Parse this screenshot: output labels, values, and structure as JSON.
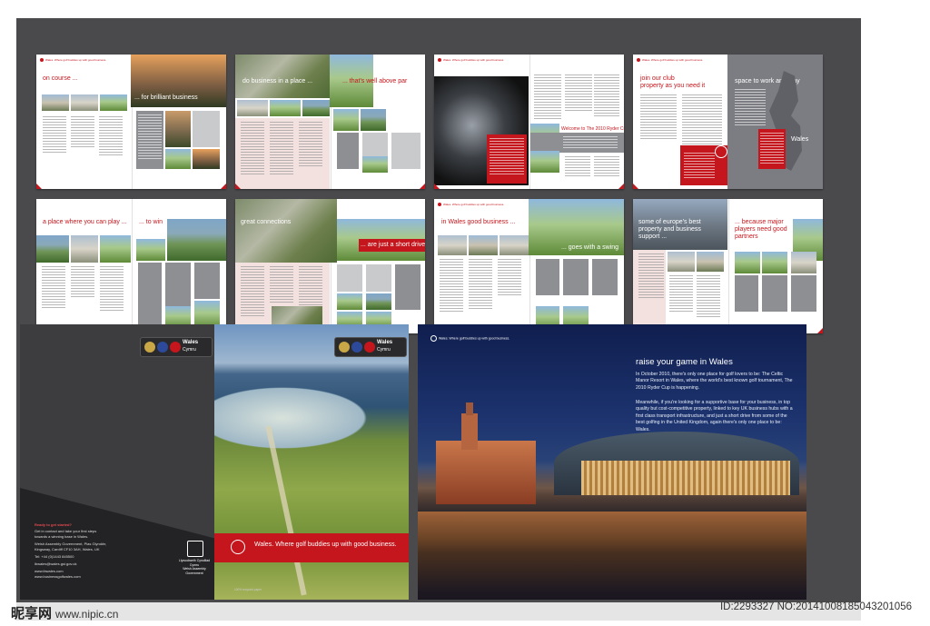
{
  "runner_text": "Wales. Where golf buddies up with good business.",
  "spreads": [
    {
      "id": "on-course",
      "headings": [
        "on course ...",
        "... for brilliant business"
      ]
    },
    {
      "id": "business-place",
      "headings": [
        "do business in a place ...",
        "... that's well above par"
      ]
    },
    {
      "id": "ryder-cup",
      "headings": [
        "Welcome to The 2010 Ryder Cup"
      ]
    },
    {
      "id": "club-property",
      "headings": [
        "join our club",
        "property as you need it",
        "space to work and play",
        "Wales"
      ]
    },
    {
      "id": "place-to-play",
      "headings": [
        "a place where you can play ...",
        "... to win"
      ]
    },
    {
      "id": "great-connections",
      "headings": [
        "great connections",
        "... are just a short drive"
      ]
    },
    {
      "id": "good-business",
      "headings": [
        "in Wales good business ...",
        "... goes with a swing"
      ]
    },
    {
      "id": "europe-best",
      "headings": [
        "some of europe's best property and business support ...",
        "... because major players need good partners"
      ]
    }
  ],
  "cover": {
    "badge_title": "Wales",
    "badge_sub": "Cymru",
    "slogan": "Wales. Where golf buddies up with good business.",
    "contact_heading": "Ready to get started?",
    "contact_lines": [
      "Get in contact and take your first steps",
      "towards a winning base in Wales.",
      "Welsh Assembly Government, Plas Glyndŵr,",
      "Kingsway, Cardiff CF10 3AH, Wales, UK",
      "Tel: +44 (0)1443 845500",
      "ibwales@wales.gsi.gov.uk",
      "www.ibwales.com",
      "www.businessgolfwales.com"
    ],
    "gov_line1": "Llywodraeth Cynulliad Cymru",
    "gov_line2": "Welsh Assembly Government",
    "footer": "100% recycled paper"
  },
  "inner": {
    "header": "Wales. Where golf buddies up with good business.",
    "title": "raise your game in Wales",
    "para1": "In October 2010, there's only one place for golf lovers to be: The Celtic Manor Resort in Wales, where the world's best known golf tournament, The 2010 Ryder Cup is happening.",
    "para2": "Meanwhile, if you're looking for a supportive base for your business, in top quality but cost-competitive property, linked to key UK business hubs with a first class transport infrastructure, and just a short drive from some of the best golfing in the United Kingdom, again there's only one place to be: Wales."
  },
  "watermark": {
    "site": "昵享网",
    "url": "www.nipic.cn",
    "id": "ID:2293327 NO:20141008185043201056"
  }
}
